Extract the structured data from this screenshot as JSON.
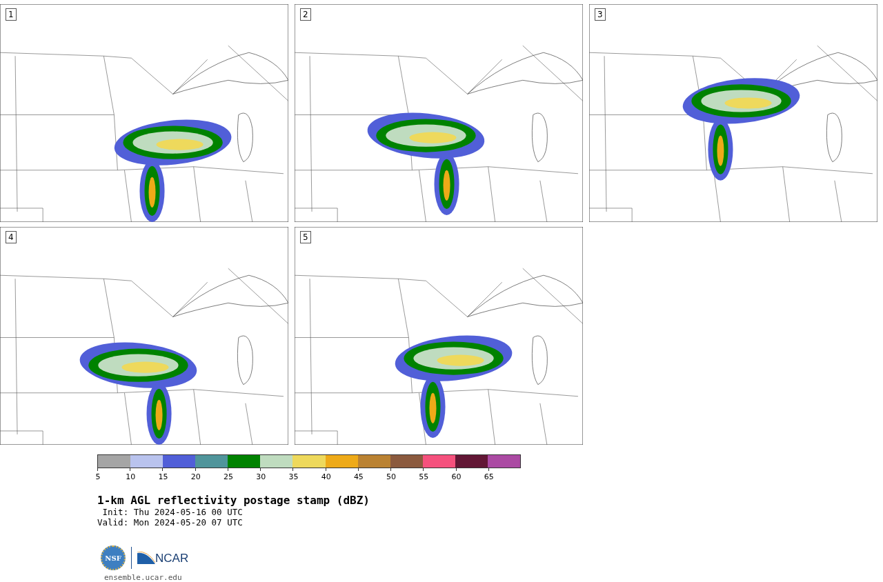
{
  "panels": [
    {
      "label": "1"
    },
    {
      "label": "2"
    },
    {
      "label": "3"
    },
    {
      "label": "4"
    },
    {
      "label": "5"
    }
  ],
  "colorbar": {
    "bins": [
      {
        "color": "#a5a5a5"
      },
      {
        "color": "#b9c3ee"
      },
      {
        "color": "#515fd8"
      },
      {
        "color": "#50959b"
      },
      {
        "color": "#008200"
      },
      {
        "color": "#bfdcbf"
      },
      {
        "color": "#eed95c"
      },
      {
        "color": "#eeaa18"
      },
      {
        "color": "#ba8232"
      },
      {
        "color": "#8b5a3e"
      },
      {
        "color": "#f5517d"
      },
      {
        "color": "#621735"
      },
      {
        "color": "#ab4aa3"
      }
    ],
    "ticks": [
      "5",
      "10",
      "15",
      "20",
      "25",
      "30",
      "35",
      "40",
      "45",
      "50",
      "55",
      "60",
      "65"
    ]
  },
  "title": "1-km AGL reflectivity postage stamp (dBZ)",
  "init": " Init: Thu 2024-05-16 00 UTC",
  "valid": "Valid: Mon 2024-05-20 07 UTC",
  "logos": {
    "nsf": "NSF",
    "ncar": "NCAR"
  },
  "footer": "ensemble.ucar.edu"
}
